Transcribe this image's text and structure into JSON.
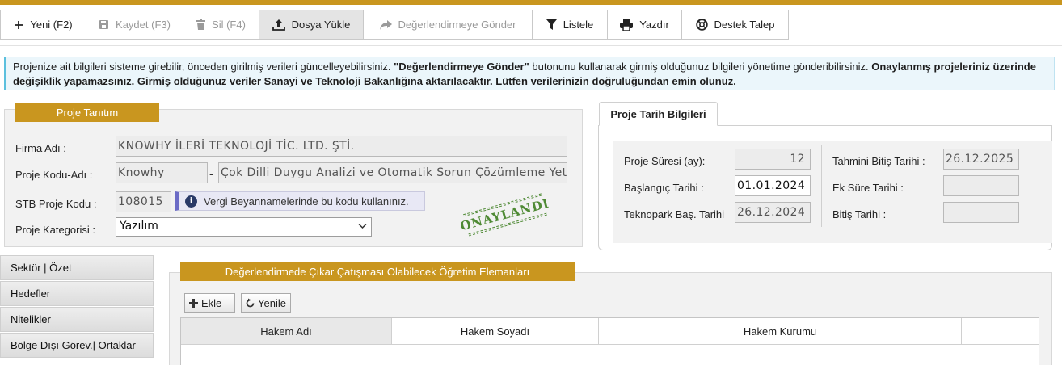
{
  "toolbar": {
    "new_label": "Yeni (F2)",
    "save_label": "Kaydet (F3)",
    "delete_label": "Sil (F4)",
    "upload_label": "Dosya Yükle",
    "send_label": "Değerlendirmeye Gönder",
    "list_label": "Listele",
    "print_label": "Yazdır",
    "support_label": "Destek Talep"
  },
  "info": {
    "text1": "Projenize ait bilgileri sisteme girebilir, önceden girilmiş verileri güncelleyebilirsiniz. ",
    "bold1": "\"Değerlendirmeye Gönder\"",
    "text2": " butonunu kullanarak girmiş olduğunuz bilgileri yönetime gönderibilirsiniz. ",
    "bold2": "Onaylanmış projeleriniz üzerinde değişiklik yapamazsınız. Girmiş olduğunuz veriler Sanayi ve Teknoloji Bakanlığına aktarılacaktır. Lütfen verilerinizin doğruluğundan emin olunuz."
  },
  "project": {
    "section_title": "Proje Tanıtım",
    "firma_label": "Firma Adı :",
    "firma_value": "KNOWHY İLERİ TEKNOLOJİ TİC. LTD. ŞTİ.",
    "kod_label": "Proje Kodu-Adı :",
    "kod_value": "Knowhy",
    "kod_separator": "-",
    "ad_value": "Çok Dilli Duygu Analizi ve Otomatik Sorun Çözümleme Yetene",
    "stb_label": "STB Proje Kodu :",
    "stb_value": "108015",
    "vergi_note": "Vergi Beyannamelerinde bu kodu kullanınız.",
    "stamp_text": "ONAYLANDI",
    "kategori_label": "Proje Kategorisi :",
    "kategori_value": "Yazılım"
  },
  "dates": {
    "tab_title": "Proje Tarih Bilgileri",
    "sure_label": "Proje Süresi (ay):",
    "sure_value": "12",
    "baslangic_label": "Başlangıç Tarihi :",
    "baslangic_value": "01.01.2024",
    "teknopark_label": "Teknopark Baş. Tarihi",
    "teknopark_value": "26.12.2024",
    "tahmini_label": "Tahmini Bitiş Tarihi :",
    "tahmini_value": "26.12.2025",
    "ek_sure_label": "Ek Süre Tarihi :",
    "ek_sure_value": "",
    "bitis_label": "Bitiş Tarihi :",
    "bitis_value": ""
  },
  "sidebar": {
    "items": [
      {
        "label": "Sektör | Özet"
      },
      {
        "label": "Hedefler"
      },
      {
        "label": "Nitelikler"
      },
      {
        "label": "Bölge Dışı Görev.| Ortaklar"
      }
    ]
  },
  "hakem": {
    "section_title": "Değerlendirmede Çıkar Çatışması Olabilecek Öğretim Elemanları",
    "add_label": "Ekle",
    "refresh_label": "Yenile",
    "columns": [
      "Hakem Adı",
      "Hakem Soyadı",
      "Hakem Kurumu",
      ""
    ]
  },
  "colors": {
    "accent": "#c9961f",
    "stamp": "#4f8a35",
    "info_bg": "#ebf6fb"
  }
}
